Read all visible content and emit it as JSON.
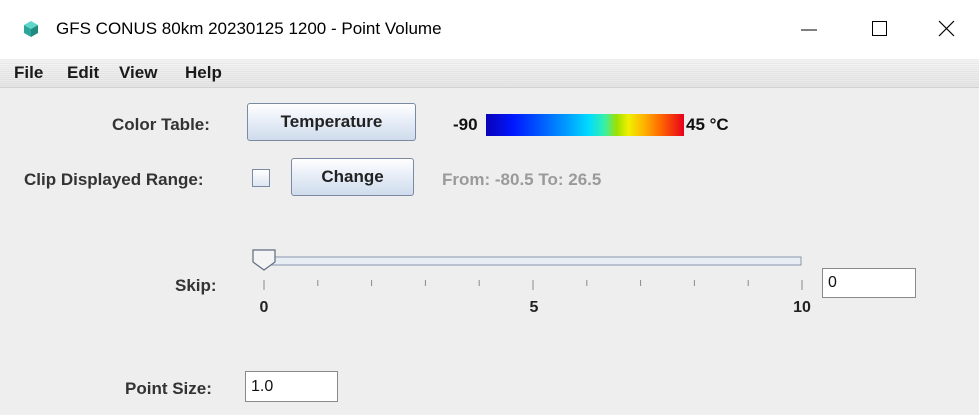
{
  "window": {
    "title": "GFS CONUS 80km 20230125 1200 - Point Volume",
    "icon": "cube-icon"
  },
  "menubar": {
    "items": [
      {
        "label": "File"
      },
      {
        "label": "Edit"
      },
      {
        "label": "View"
      },
      {
        "label": "Help"
      }
    ]
  },
  "color_table": {
    "label": "Color Table:",
    "button_label": "Temperature",
    "min": "-90",
    "max": "45 °C"
  },
  "clip_range": {
    "label": "Clip Displayed Range:",
    "checked": false,
    "button_label": "Change",
    "range_text": "From: -80.5 To: 26.5"
  },
  "skip": {
    "label": "Skip:",
    "value": 0,
    "min": 0,
    "max": 10,
    "tick_labels": [
      "0",
      "5",
      "10"
    ],
    "field_value": "0"
  },
  "point_size": {
    "label": "Point Size:",
    "value": "1.0"
  },
  "colors": {
    "background": "#eeeeee",
    "disabled_text": "#9a9a9a"
  }
}
